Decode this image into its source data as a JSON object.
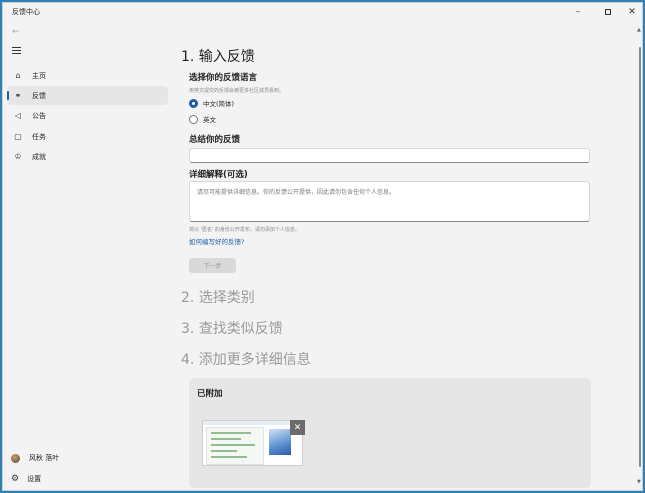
{
  "window": {
    "title": "反馈中心"
  },
  "sidebar": {
    "items": [
      {
        "label": "主页",
        "icon": "home-icon"
      },
      {
        "label": "反馈",
        "icon": "feedback-icon"
      },
      {
        "label": "公告",
        "icon": "megaphone-icon"
      },
      {
        "label": "任务",
        "icon": "quest-icon"
      },
      {
        "label": "成就",
        "icon": "trophy-icon"
      }
    ],
    "active_index": 1,
    "user_name": "风秋 落叶",
    "settings_label": "设置"
  },
  "steps": {
    "step1": "1. 输入反馈",
    "step2": "2. 选择类别",
    "step3": "3. 查找类似反馈",
    "step4": "4. 添加更多详细信息"
  },
  "language": {
    "label": "选择你的反馈语言",
    "hint": "用英文提交的反馈会被更多社区成员看到。",
    "options": [
      "中文(简体)",
      "英文"
    ],
    "selected": "中文(简体)"
  },
  "summary": {
    "label": "总结你的反馈",
    "value": ""
  },
  "details": {
    "label": "详细解释(可选)",
    "placeholder": "请尽可能提供详细信息。你的反馈公开提供，因此请勿包含任何个人信息。",
    "disclaimer": "将以 '匿名' 的身份公开发布，请勿添加个人信息。",
    "help_link": "如何编写好的反馈?"
  },
  "next_button": "下一步",
  "attachments": {
    "title": "已附加"
  },
  "colors": {
    "accent": "#1a5fa8",
    "background": "#f3f3f3"
  }
}
